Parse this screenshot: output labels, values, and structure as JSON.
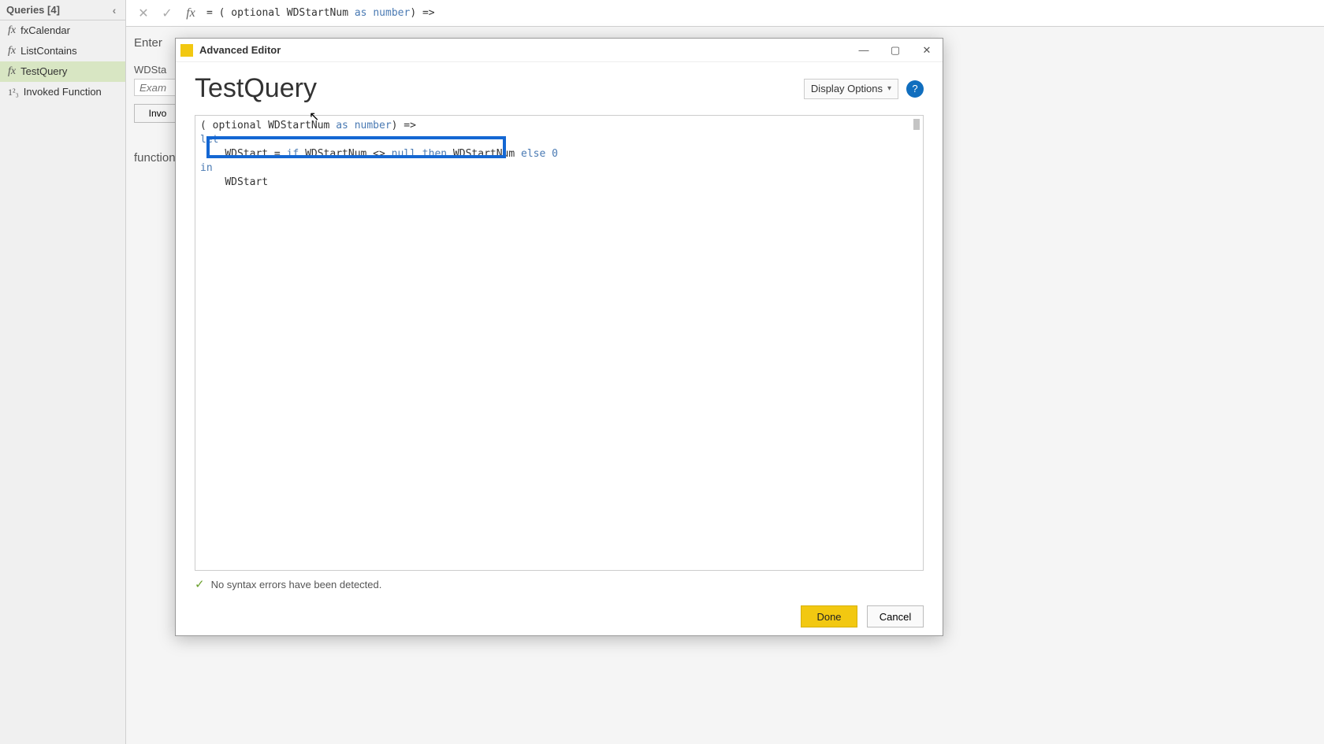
{
  "queries_panel": {
    "title": "Queries [4]",
    "items": [
      {
        "icon": "fx",
        "label": "fxCalendar"
      },
      {
        "icon": "fx",
        "label": "ListContains"
      },
      {
        "icon": "fx",
        "label": "TestQuery"
      },
      {
        "icon": "123",
        "label": "Invoked Function"
      }
    ],
    "selected_index": 2
  },
  "formula_bar": {
    "prefix": "= ",
    "tokens": [
      {
        "t": "(",
        "c": ""
      },
      {
        "t": " optional WDStartNum ",
        "c": ""
      },
      {
        "t": "as",
        "c": "kw"
      },
      {
        "t": " ",
        "c": ""
      },
      {
        "t": "number",
        "c": "kw"
      },
      {
        "t": ") =>",
        "c": ""
      }
    ]
  },
  "bg": {
    "enter_label": "Enter",
    "param_label": "WDSta",
    "example_placeholder": "Exam",
    "invoke_label": "Invo",
    "function_label": "function"
  },
  "dialog": {
    "title": "Advanced Editor",
    "query_name": "TestQuery",
    "display_options_label": "Display Options",
    "code_lines": [
      {
        "indent": "",
        "tokens": [
          {
            "t": "(",
            "c": ""
          },
          {
            "t": " optional WDStartNum ",
            "c": ""
          },
          {
            "t": "as",
            "c": "tok-kw"
          },
          {
            "t": " ",
            "c": ""
          },
          {
            "t": "number",
            "c": "tok-type"
          },
          {
            "t": ") =>",
            "c": ""
          }
        ]
      },
      {
        "indent": "",
        "tokens": [
          {
            "t": "let",
            "c": "tok-kw"
          }
        ]
      },
      {
        "indent": "    ",
        "tokens": [
          {
            "t": "WDStart = ",
            "c": ""
          },
          {
            "t": "if",
            "c": "tok-kw"
          },
          {
            "t": " WDStartNum <> ",
            "c": ""
          },
          {
            "t": "null",
            "c": "tok-null"
          },
          {
            "t": " ",
            "c": ""
          },
          {
            "t": "then",
            "c": "tok-kw"
          },
          {
            "t": " WDStartNum ",
            "c": ""
          },
          {
            "t": "else",
            "c": "tok-kw"
          },
          {
            "t": " ",
            "c": ""
          },
          {
            "t": "0",
            "c": "tok-num"
          }
        ]
      },
      {
        "indent": "",
        "tokens": [
          {
            "t": "in",
            "c": "tok-kw"
          }
        ]
      },
      {
        "indent": "    ",
        "tokens": [
          {
            "t": "WDStart",
            "c": ""
          }
        ]
      }
    ],
    "status_text": "No syntax errors have been detected.",
    "done_label": "Done",
    "cancel_label": "Cancel"
  }
}
